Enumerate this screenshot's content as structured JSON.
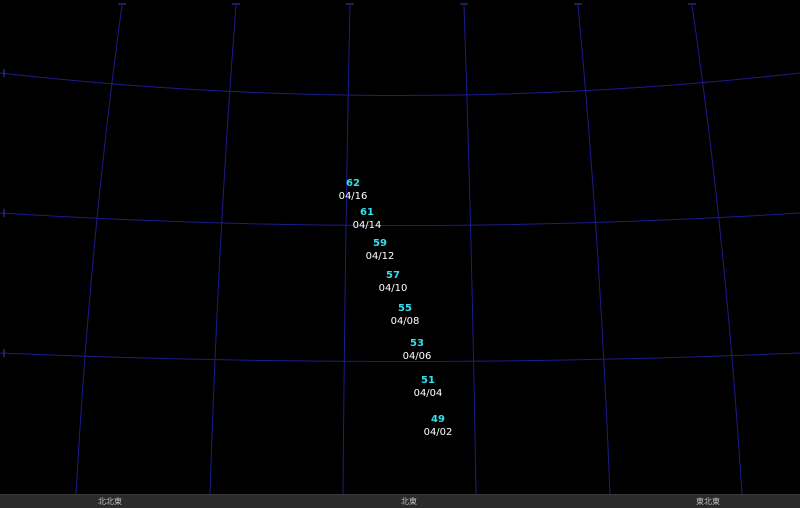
{
  "colors": {
    "background": "#000000",
    "grid_line": "#1c1c8c",
    "altitude_text": "#33e0f0",
    "date_text": "#ffffff",
    "horizon_bar": "#2b2b2b",
    "direction_text": "#bfbfbf"
  },
  "track": [
    {
      "altitude": "62",
      "date": "04/16"
    },
    {
      "altitude": "61",
      "date": "04/14"
    },
    {
      "altitude": "59",
      "date": "04/12"
    },
    {
      "altitude": "57",
      "date": "04/10"
    },
    {
      "altitude": "55",
      "date": "04/08"
    },
    {
      "altitude": "53",
      "date": "04/06"
    },
    {
      "altitude": "51",
      "date": "04/04"
    },
    {
      "altitude": "49",
      "date": "04/02"
    }
  ],
  "horizon": {
    "left_label": "北北東",
    "center_label": "北東",
    "right_label": "東北東"
  }
}
